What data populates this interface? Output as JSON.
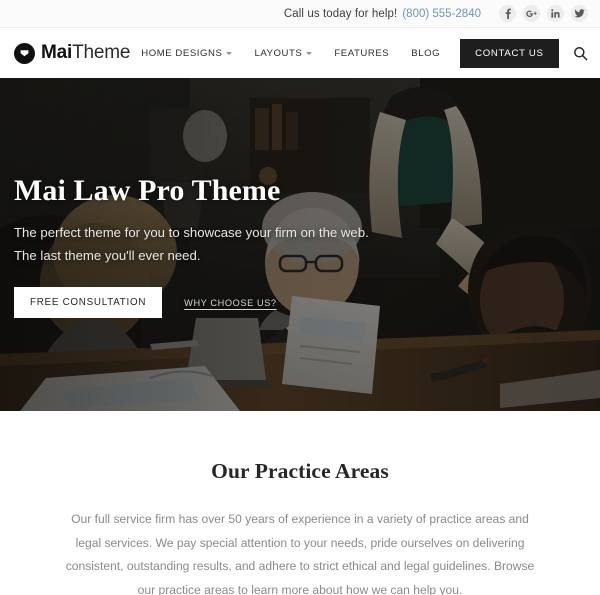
{
  "topbar": {
    "help_text": "Call us today for help!",
    "phone": "(800) 555-2840",
    "socials": [
      {
        "name": "facebook-icon",
        "glyph": "f"
      },
      {
        "name": "google-plus-icon",
        "glyph": "G+"
      },
      {
        "name": "linkedin-icon",
        "glyph": "in"
      },
      {
        "name": "twitter-icon",
        "glyph": "t"
      }
    ]
  },
  "header": {
    "logo": {
      "bold": "Mai",
      "light": "Theme",
      "mark": "envelope-mark-icon"
    },
    "nav": [
      {
        "label": "Home Designs",
        "has_dropdown": true
      },
      {
        "label": "Layouts",
        "has_dropdown": true
      },
      {
        "label": "Features",
        "has_dropdown": false
      },
      {
        "label": "Blog",
        "has_dropdown": false
      }
    ],
    "cta_label": "Contact Us",
    "search_icon": "search-icon"
  },
  "hero": {
    "title": "Mai Law Pro Theme",
    "subtitle_line1": "The perfect theme for you to showcase your firm on the web.",
    "subtitle_line2": "The last theme you'll ever need.",
    "primary_button": "Free Consultation",
    "secondary_link": "Why Choose Us?"
  },
  "practice": {
    "heading": "Our Practice Areas",
    "paragraph": "Our full service firm has over 50 years of experience in a variety of practice areas and legal services. We pay special attention to your needs, pride ourselves on delivering consistent, outstanding results, and adhere to strict ethical and legal guidelines. Browse our practice areas to learn more about how we can help you."
  },
  "colors": {
    "accent_phone": "#7093b8",
    "cta_background": "#1e1e1e",
    "topbar_background": "#fbfbfb",
    "text_dark": "#262626",
    "text_muted": "#8a8a8a"
  }
}
